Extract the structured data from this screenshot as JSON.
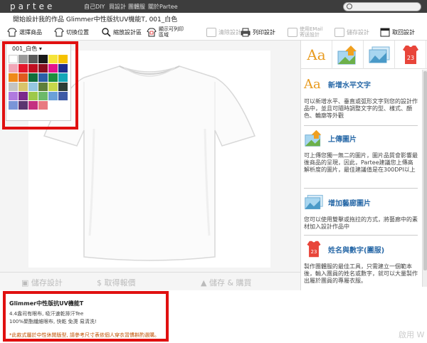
{
  "topbar": {
    "logo": "partee",
    "nav": [
      "自己DIY",
      "買設計",
      "團體服",
      "關於Partee"
    ]
  },
  "title": "開始設計我的作品 Glimmer中性版抗UV機能T, 001_白色",
  "toolbar": {
    "select_product": "選擇商品",
    "switch_position": "切換位置",
    "zoom_design_area": "縮放設計區",
    "print_area": [
      "顯示可列印",
      "區域"
    ],
    "clear_design": "清除設計",
    "print_design": "列印設計",
    "email_design": [
      "使用EMail",
      "寄送設計"
    ],
    "save_design": "儲存設計",
    "load_design": "取回設計"
  },
  "color_panel": {
    "selected": "001_白色",
    "swatches": [
      "#ffffff",
      "#9a9a9a",
      "#595959",
      "#1a1a1a",
      "#f5e43a",
      "#f6c200",
      "#f1a7b8",
      "#e4172c",
      "#c00d20",
      "#8b0d1c",
      "#e3148c",
      "#1f2d8c",
      "#ef8a1a",
      "#e05a20",
      "#0f6e3a",
      "#2b5fa8",
      "#1e8e3e",
      "#15a7b8",
      "#c4c4c4",
      "#d8c46a",
      "#95c7e0",
      "#5f7f3a",
      "#c7d84a",
      "#2e3e36",
      "#b07adf",
      "#7b2a8c",
      "#9ec94a",
      "#6cb96a",
      "#6aa0d8",
      "#3d5aa6",
      "#7a95d8",
      "#5a3570",
      "#c43080",
      "#e87a80"
    ]
  },
  "savebar": {
    "save_design": "儲存設計",
    "get_quote": "取得報價",
    "save_buy": "儲存 & 購買"
  },
  "product": {
    "name": "Glimmer中性版抗UV機能T",
    "desc1": "4.4盎司有眼布, 吸汗速乾排汗Tee",
    "desc2": "100%聚酯纖維眼布, 快乾 免燙 易清洗!",
    "note": "*此款式屬於中性休閒版型, 請參考尺寸表依個人穿衣習慣斟酌選購。"
  },
  "features": [
    {
      "title": "新增水平文字",
      "desc": "可以新增水平、垂直或弧形文字到您的設計作品中，並且可隨時調整文字的型、樣式、顏色、輪廓等外觀",
      "icon": "text-aa-icon"
    },
    {
      "title": "上傳圖片",
      "desc": "可上傳您獨一無二的圖片，圖片品質會影響最後商品的呈現，因此，Partee建議您上傳高解析度的圖片，最佳建議值是在300DPI以上",
      "icon": "upload-image-icon"
    },
    {
      "title": "增加藝廊圖片",
      "desc": "您可以使用雙擊或拖拉的方式，將藝廊中的素材加入設計作品中",
      "icon": "gallery-icon"
    },
    {
      "title": "姓名與數字(團服)",
      "desc": "製作團體服的最佳工具，只需建立一個範本後，輸入團員的姓名或數字，就可以大量製作出屬於團員的專屬衣服。",
      "icon": "jersey-icon"
    }
  ],
  "jersey_number": "23",
  "watermark": "啟用 W",
  "colors": {
    "topbar": "#3d3d3d",
    "accent_title": "#2a6aa8",
    "highlight": "#e01010",
    "note": "#c05000"
  }
}
